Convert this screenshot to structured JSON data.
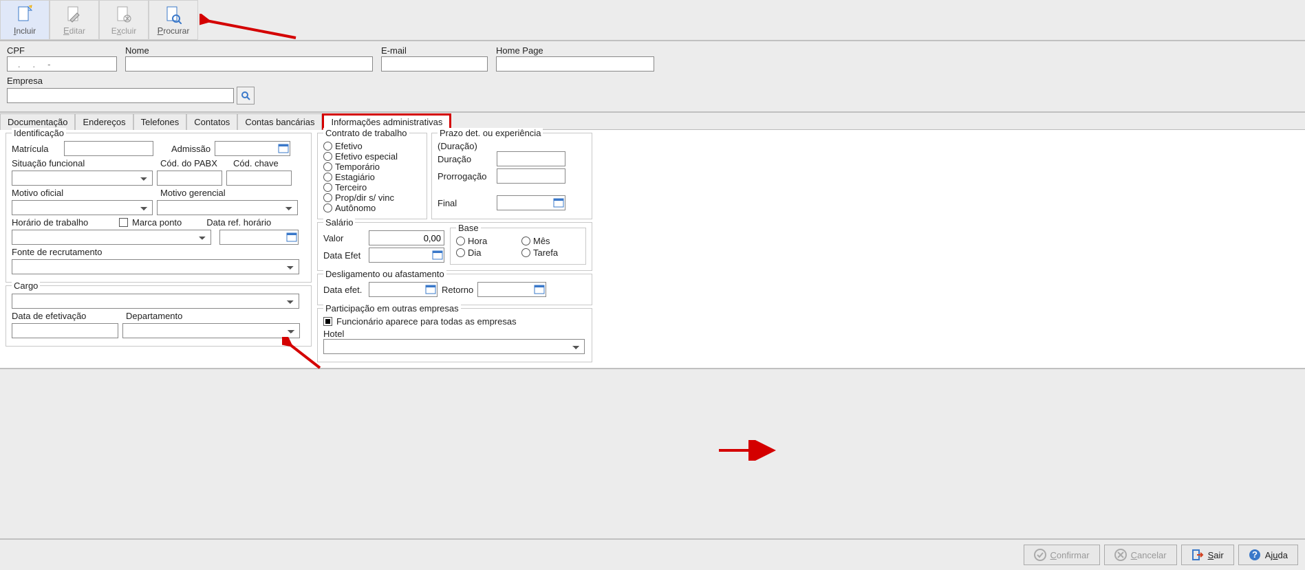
{
  "toolbar": {
    "incluir": "Incluir",
    "editar": "Editar",
    "excluir": "Excluir",
    "procurar": "Procurar"
  },
  "header": {
    "cpf_label": "CPF",
    "cpf_value": "   .     .     -",
    "nome_label": "Nome",
    "nome_value": "",
    "email_label": "E-mail",
    "email_value": "",
    "homepage_label": "Home Page",
    "homepage_value": "",
    "empresa_label": "Empresa",
    "empresa_value": ""
  },
  "tabs": {
    "documentacao": "Documentação",
    "enderecos": "Endereços",
    "telefones": "Telefones",
    "contatos": "Contatos",
    "contas": "Contas bancárias",
    "info_admin": "Informações administrativas"
  },
  "ident": {
    "legend": "Identificação",
    "matricula": "Matrícula",
    "admissao": "Admissão",
    "situacao": "Situação funcional",
    "cod_pabx": "Cód. do PABX",
    "cod_chave": "Cód. chave",
    "motivo_of": "Motivo oficial",
    "motivo_ger": "Motivo gerencial",
    "horario": "Horário de trabalho",
    "marca_ponto": "Marca ponto",
    "data_ref": "Data ref. horário",
    "fonte": "Fonte de recrutamento"
  },
  "cargo": {
    "legend": "Cargo",
    "data_efet": "Data de efetivação",
    "departamento": "Departamento"
  },
  "contrato": {
    "legend": "Contrato de trabalho",
    "efetivo": "Efetivo",
    "efetivo_esp": "Efetivo especial",
    "temporario": "Temporário",
    "estagiario": "Estagiário",
    "terceiro": "Terceiro",
    "propdir": "Prop/dir s/ vinc",
    "autonomo": "Autônomo"
  },
  "prazo": {
    "legend": "Prazo det. ou experiência",
    "duracao_grp": "(Duração)",
    "duracao": "Duração",
    "prorrogacao": "Prorrogação",
    "final": "Final"
  },
  "salario": {
    "legend": "Salário",
    "valor": "Valor",
    "valor_val": "0,00",
    "data_efet": "Data Efet",
    "base": "Base",
    "hora": "Hora",
    "mes": "Mês",
    "dia": "Dia",
    "tarefa": "Tarefa"
  },
  "deslig": {
    "legend": "Desligamento ou afastamento",
    "data_efet": "Data efet.",
    "retorno": "Retorno"
  },
  "part": {
    "legend": "Participação em outras empresas",
    "func_todas": "Funcionário aparece para todas as empresas",
    "hotel": "Hotel"
  },
  "footer": {
    "confirmar": "Confirmar",
    "cancelar": "Cancelar",
    "sair": "Sair",
    "ajuda": "Ajuda"
  }
}
